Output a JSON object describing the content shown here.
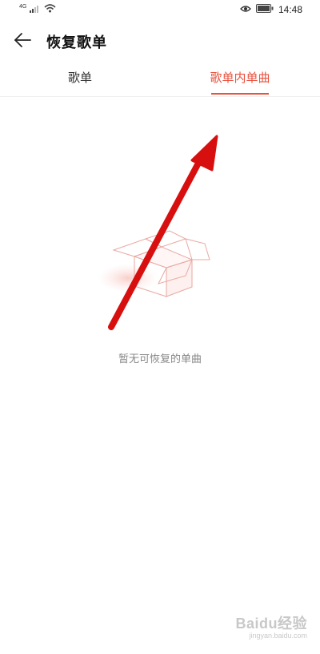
{
  "status_bar": {
    "network_label": "4G",
    "time": "14:48",
    "icons": [
      "signal-icon",
      "wifi-icon",
      "eye-comfort-icon",
      "battery-icon"
    ]
  },
  "header": {
    "back_icon": "arrow-left-icon",
    "title": "恢复歌单"
  },
  "tabs": [
    {
      "label": "歌单",
      "active": false
    },
    {
      "label": "歌单内单曲",
      "active": true
    }
  ],
  "empty_state": {
    "illustration": "open-box-icon",
    "message": "暂无可恢复的单曲"
  },
  "watermark": {
    "main": "Baidu经验",
    "sub": "jingyan.baidu.com"
  },
  "colors": {
    "accent": "#e8523f",
    "annotation": "#e01010",
    "text_primary": "#111111",
    "text_secondary": "#888888"
  }
}
